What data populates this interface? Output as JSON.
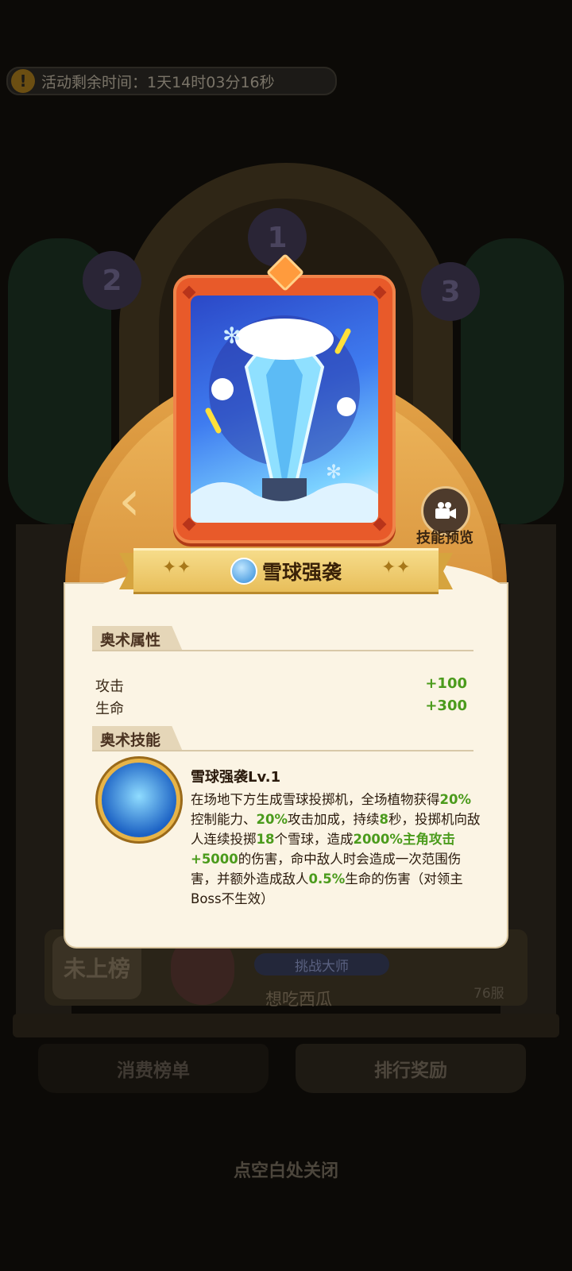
{
  "background": {
    "timer_text": "活动剩余时间：1天14时03分16秒",
    "podium_ranks": [
      "1",
      "2",
      "3"
    ],
    "rank_status": "未上榜",
    "player_title": "挑战大师",
    "player_name": "想吃西瓜",
    "server": "76服",
    "tabs": [
      "消费榜单",
      "排行奖励"
    ],
    "close_hint": "点空白处关闭"
  },
  "popup": {
    "card_name": "雪球强袭",
    "video_preview_label": "技能预览",
    "attributes_title": "奥术属性",
    "attributes": [
      {
        "label": "攻击",
        "value": "+100"
      },
      {
        "label": "生命",
        "value": "+300"
      }
    ],
    "skill_section_title": "奥术技能",
    "skill": {
      "name": "雪球强袭Lv.1",
      "desc_parts": [
        {
          "t": "在场地下方生成雪球投掷机，全场植物获得",
          "hl": false
        },
        {
          "t": "20%",
          "hl": true
        },
        {
          "t": "控制能力、",
          "hl": false
        },
        {
          "t": "20%",
          "hl": true
        },
        {
          "t": "攻击加成，持续",
          "hl": false
        },
        {
          "t": "8",
          "hl": true
        },
        {
          "t": "秒，投掷机向敌人连续投掷",
          "hl": false
        },
        {
          "t": "18",
          "hl": true
        },
        {
          "t": "个雪球，造成",
          "hl": false
        },
        {
          "t": "2000%主角攻击+5000",
          "hl": true
        },
        {
          "t": "的伤害，命中敌人时会造成一次范围伤害，并额外造成敌人",
          "hl": false
        },
        {
          "t": "0.5%",
          "hl": true
        },
        {
          "t": "生命的伤害（对领主Boss不生效）",
          "hl": false
        }
      ]
    }
  },
  "colors": {
    "highlight_green": "#4b9b1c",
    "card_frame": "#e85a2a",
    "popup_bg": "#fbf4e4"
  }
}
